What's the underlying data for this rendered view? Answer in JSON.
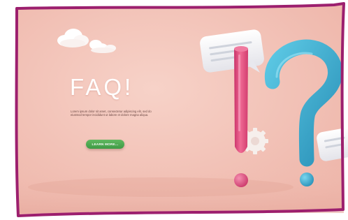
{
  "banner": {
    "title": "FAQ!",
    "body": "Lorem ipsum dolor sit amet, consectetur adipiscing elit, sed do eiusmod tempor incididunt ut labore et dolore magna aliqua.",
    "button_label": "LEARN MORE..."
  },
  "colors": {
    "background": "#f3c4b8",
    "frame": "#9c1f6e",
    "exclamation": "#e8527e",
    "question": "#3aaed0",
    "button": "#4caa50",
    "speech_bubble": "#f4f4f6"
  },
  "icons": [
    "cloud-icon",
    "speech-bubble-icon",
    "exclamation-mark-icon",
    "question-mark-icon",
    "gear-icon"
  ]
}
